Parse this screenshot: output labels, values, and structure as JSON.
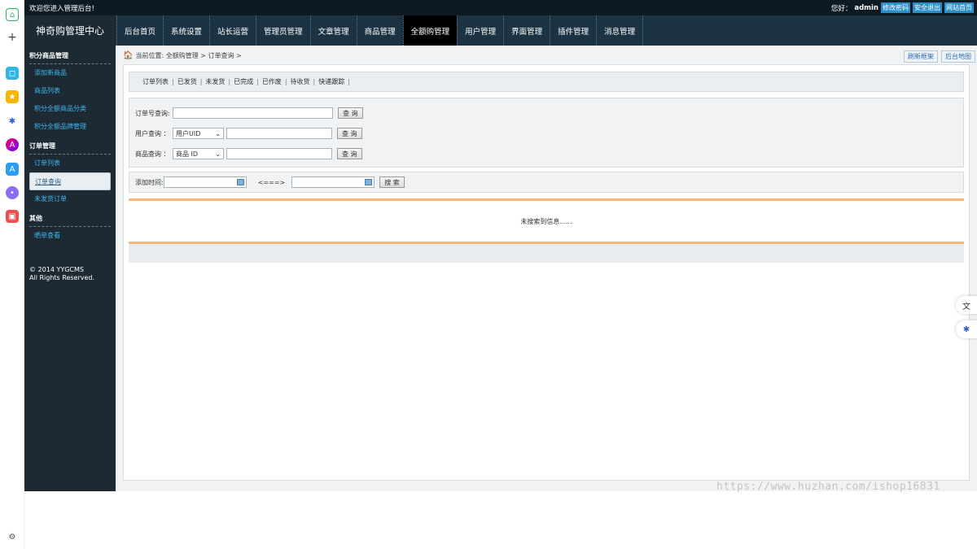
{
  "topbar": {
    "welcome": "欢迎您进入管理后台!",
    "greeting": "您好：",
    "username": "admin",
    "links": [
      "修改密码",
      "安全退出",
      "网站首页"
    ]
  },
  "brand": "神奇购管理中心",
  "nav": [
    {
      "label": "后台首页"
    },
    {
      "label": "系统设置"
    },
    {
      "label": "站长运营"
    },
    {
      "label": "管理员管理"
    },
    {
      "label": "文章管理"
    },
    {
      "label": "商品管理"
    },
    {
      "label": "全额购管理",
      "active": true
    },
    {
      "label": "用户管理"
    },
    {
      "label": "界面管理"
    },
    {
      "label": "插件管理"
    },
    {
      "label": "消息管理"
    }
  ],
  "sidebar": {
    "sections": [
      {
        "title": "积分商品管理",
        "items": [
          "添加新商品",
          "商品列表",
          "积分全额商品分类",
          "积分全额品牌管理"
        ]
      },
      {
        "title": "订单管理",
        "items": [
          "订单列表",
          "订单查询",
          "未发货订单"
        ]
      },
      {
        "title": "其他",
        "items": [
          "晒单查看"
        ]
      }
    ],
    "current": "订单查询",
    "copyright_line1": "© 2014 YYGCMS",
    "copyright_line2": "All Rights Reserved."
  },
  "breadcrumb": {
    "text": "当前位置: 全额购管理 > 订单查询 >"
  },
  "crumb_buttons": [
    "刷新框架",
    "后台地图"
  ],
  "filters": [
    "订单列表",
    "已发货",
    "未发货",
    "已完成",
    "已作废",
    "待收货",
    "快递跟踪"
  ],
  "search": {
    "order_label": "订单号查询:",
    "user_label": "用户查询 ：",
    "user_select": "用户UID",
    "goods_label": "商品查询 ：",
    "goods_select": "商品 ID",
    "query_button": "查 询"
  },
  "date_search": {
    "label": "添加时间:",
    "separator": "<===>",
    "button": "搜 索"
  },
  "result_text": "未搜索到信息......",
  "watermark": "https://www.huzhan.com/ishop16831",
  "colors": {
    "accent": "#2a8fc8",
    "nav_bg": "#1b3342",
    "sidebar_bg": "#1d2a33",
    "result_border": "#f6b97a"
  }
}
